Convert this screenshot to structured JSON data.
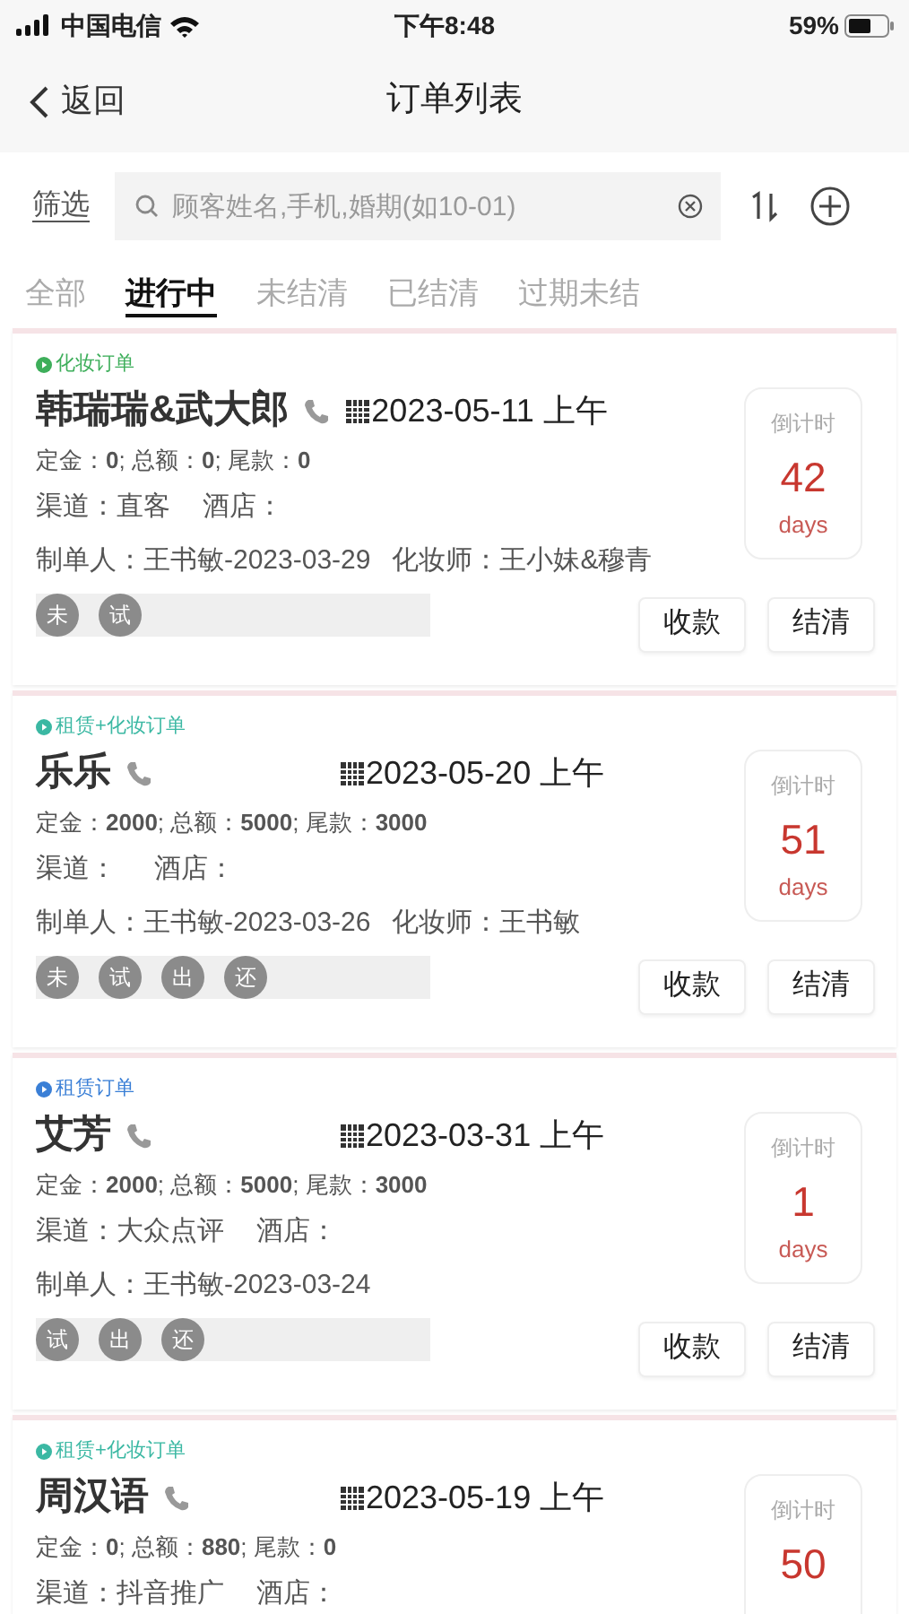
{
  "status_bar": {
    "carrier": "中国电信",
    "time": "下午8:48",
    "battery": "59%"
  },
  "nav": {
    "back": "返回",
    "title": "订单列表"
  },
  "filter": {
    "label": "筛选",
    "search": {
      "placeholder": "顾客姓名,手机,婚期(如10-01)"
    }
  },
  "tabs": [
    {
      "label": "全部",
      "selected": false
    },
    {
      "label": "进行中",
      "selected": true
    },
    {
      "label": "未结清",
      "selected": false
    },
    {
      "label": "已结清",
      "selected": false
    },
    {
      "label": "过期未结",
      "selected": false
    }
  ],
  "orders": [
    {
      "type": "化妆订单",
      "color": "#3dae5a",
      "name": "韩瑞瑞&武大郎",
      "date": "2023-05-11 上午",
      "amounts": "定金：**0**; 总额：**0**; 尾款：**0**",
      "channel": "渠道：直客",
      "hotel": "酒店：",
      "maker": "制单人：王书敏-2023-03-29",
      "artist": "化妆师：王小妹&穆青",
      "badges": [
        "未",
        "试"
      ],
      "countdown": {
        "label": "倒计时",
        "value": "42",
        "unit": "days"
      },
      "buttons": [
        "收款",
        "结清"
      ]
    },
    {
      "type": "租赁+化妆订单",
      "color": "#3bb8a3",
      "name": "乐乐",
      "date": "2023-05-20 上午",
      "amounts": "定金：**2000**; 总额：**5000**; 尾款：**3000**",
      "channel": "渠道：",
      "hotel": "酒店：",
      "maker": "制单人：王书敏-2023-03-26",
      "artist": "化妆师：王书敏",
      "badges": [
        "未",
        "试",
        "出",
        "还"
      ],
      "countdown": {
        "label": "倒计时",
        "value": "51",
        "unit": "days"
      },
      "buttons": [
        "收款",
        "结清"
      ]
    },
    {
      "type": "租赁订单",
      "color": "#3a7fd6",
      "name": "艾芳",
      "date": "2023-03-31 上午",
      "amounts": "定金：**2000**; 总额：**5000**; 尾款：**3000**",
      "channel": "渠道：大众点评",
      "hotel": "酒店：",
      "maker": "制单人：王书敏-2023-03-24",
      "badges": [
        "试",
        "出",
        "还"
      ],
      "countdown": {
        "label": "倒计时",
        "value": "1",
        "unit": "days"
      },
      "buttons": [
        "收款",
        "结清"
      ]
    },
    {
      "type": "租赁+化妆订单",
      "color": "#3bb8a3",
      "name": "周汉语",
      "date": "2023-05-19 上午",
      "amounts": "定金：**0**; 总额：**880**; 尾款：**0**",
      "channel": "渠道：抖音推广",
      "hotel": "酒店：",
      "countdown": {
        "label": "倒计时",
        "value": "50"
      }
    }
  ]
}
